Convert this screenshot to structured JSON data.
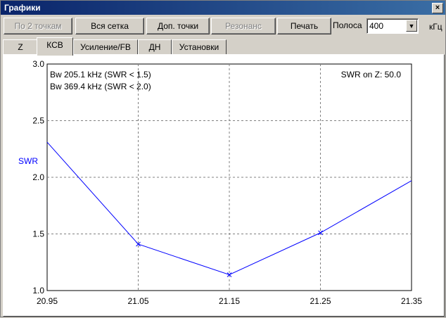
{
  "window": {
    "title": "Графики",
    "close_glyph": "×"
  },
  "toolbar": {
    "btn_two_points": "По 2 точкам",
    "btn_all_grid": "Вся сетка",
    "btn_extra_points": "Доп. точки",
    "btn_resonance": "Резонанс",
    "btn_print": "Печать",
    "band_label": "Полоса",
    "band_value": "400",
    "band_unit": "кГц"
  },
  "tabs": [
    "Z",
    "КСВ",
    "Усиление/FB",
    "ДН",
    "Установки"
  ],
  "active_tab": "КСВ",
  "chart_data": {
    "type": "line",
    "ylabel": "SWR",
    "x": [
      20.95,
      21.05,
      21.15,
      21.25,
      21.35
    ],
    "xticks": [
      "20.95",
      "21.05",
      "21.15",
      "21.25",
      "21.35"
    ],
    "yticks": [
      "1.0",
      "1.5",
      "2.0",
      "2.5",
      "3.0"
    ],
    "xlim": [
      20.95,
      21.35
    ],
    "ylim": [
      1.0,
      3.0
    ],
    "grid": true,
    "series": [
      {
        "values": [
          2.31,
          1.41,
          1.14,
          1.51,
          1.97
        ],
        "color": "#0000ff",
        "marker": "x"
      }
    ],
    "annotations": {
      "bw1": "Bw 205.1 kHz (SWR < 1.5)",
      "bw2": "Bw 369.4 kHz (SWR < 2.0)",
      "swr_on_z": "SWR on Z: 50.0"
    },
    "colors": {
      "axis_label": "#0000ff",
      "line": "#0000ff",
      "grid": "#808080"
    }
  }
}
